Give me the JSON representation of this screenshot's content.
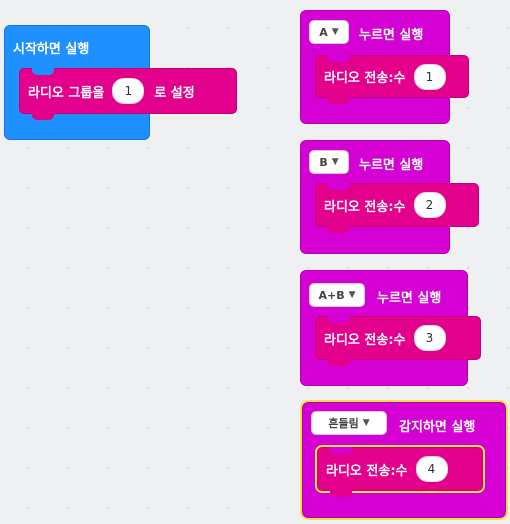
{
  "on_start": {
    "title": "시작하면 실행",
    "statement": {
      "label_before": "라디오 그룹을",
      "value": "1",
      "label_after": "로 설정"
    }
  },
  "events": [
    {
      "dropdown": "A",
      "title": "누르면 실행",
      "statement_label": "라디오 전송:수",
      "value": "1"
    },
    {
      "dropdown": "B",
      "title": "누르면 실행",
      "statement_label": "라디오 전송:수",
      "value": "2"
    },
    {
      "dropdown": "A+B",
      "title": "누르면 실행",
      "statement_label": "라디오 전송:수",
      "value": "3"
    },
    {
      "dropdown": "흔들림",
      "title": "감지하면 실행",
      "statement_label": "라디오 전송:수",
      "value": "4"
    }
  ],
  "icons": {
    "dropdown_arrow": "caret-down-icon"
  },
  "colors": {
    "start_block": "#1e90ff",
    "event_block": "#d400d4",
    "radio_block": "#e3008c",
    "selection": "#f5e246"
  }
}
